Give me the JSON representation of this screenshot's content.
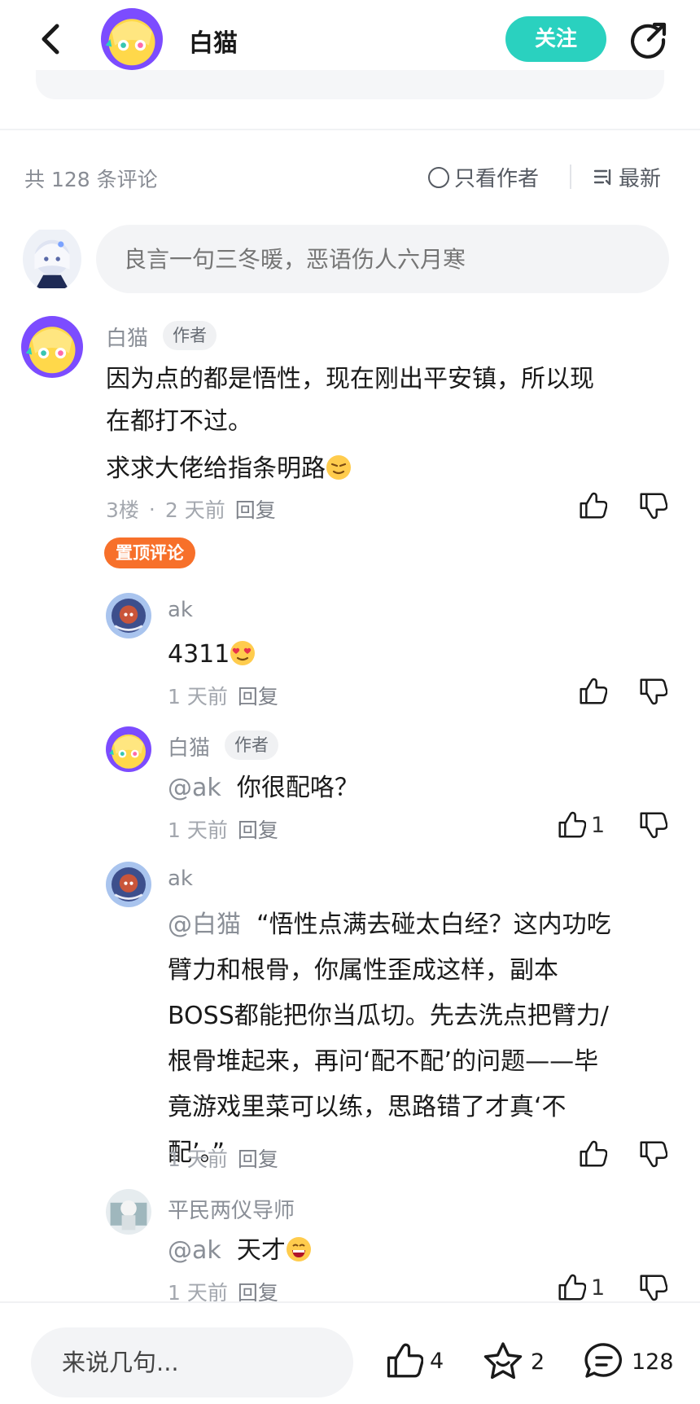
{
  "header": {
    "author_name": "白猫",
    "follow_label": "关注"
  },
  "comments_header": {
    "count_text": "共 128 条评论",
    "author_only_label": "只看作者",
    "sort_label": "最新"
  },
  "comment_input": {
    "placeholder": "良言一句三冬暖，恶语伤人六月寒"
  },
  "comments": [
    {
      "user": "白猫",
      "author_tag": "作者",
      "lines": [
        "因为点的都是悟性，现在刚出平安镇，所以现",
        "在都打不过。",
        "求求大佬给指条明路"
      ],
      "floor": "3楼",
      "dot": "·",
      "time": "2 天前",
      "reply_label": "回复",
      "pin_label": "置顶评论"
    }
  ],
  "replies": [
    {
      "user": "ak",
      "text": "4311",
      "time": "1 天前",
      "reply_label": "回复"
    },
    {
      "user": "白猫",
      "author_tag": "作者",
      "mention": "@ak",
      "text": "你很配咯？",
      "time": "1 天前",
      "reply_label": "回复",
      "likes": "1"
    },
    {
      "user": "ak",
      "mention": "@白猫",
      "lines": [
        "“悟性点满去碰太白经？这内功吃",
        "臂力和根骨，你属性歪成这样，副本",
        "BOSS都能把你当瓜切。先去洗点把臂力/",
        "根骨堆起来，再问‘配不配’的问题——毕",
        "竟游戏里菜可以练，思路错了才真‘不",
        "配’。”"
      ],
      "time": "1 天前",
      "reply_label": "回复"
    },
    {
      "user": "平民两仪导师",
      "mention": "@ak",
      "text": "天才",
      "time": "1 天前",
      "reply_label": "回复",
      "likes": "1"
    }
  ],
  "bottom_bar": {
    "input_placeholder": "来说几句...",
    "likes": "4",
    "favorites": "2",
    "comments": "128"
  },
  "colors": {
    "accent": "#2ad1bf",
    "pin": "#f7702a",
    "muted_text": "#8a8f97"
  },
  "icons": [
    "back-icon",
    "share-icon",
    "radio-icon",
    "sort-icon",
    "thumb-up-icon",
    "thumb-down-icon",
    "star-icon",
    "comment-icon"
  ]
}
